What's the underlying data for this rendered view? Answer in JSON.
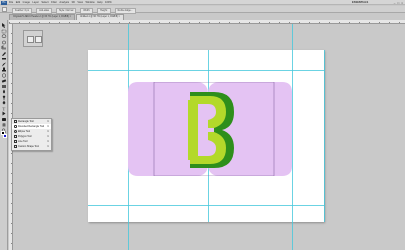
{
  "app": {
    "logo": "Ps",
    "essentials_label": "ESSENTIALS"
  },
  "menu": {
    "items": [
      "File",
      "Edit",
      "Image",
      "Layer",
      "Select",
      "Filter",
      "Analysis",
      "3D",
      "View",
      "Window",
      "Help"
    ],
    "zoom_value": "100%"
  },
  "window_controls": [
    "–",
    "□",
    "×"
  ],
  "options_bar": {
    "items": [
      "Feather: 0 px",
      "Anti-alias",
      "Style: Normal",
      "Width:",
      "Height:",
      "Refine Edge..."
    ]
  },
  "tabs": [
    {
      "label": "Original-Hi-3E9.6 Header-2 @ 66.7% (Layer 1, RGB/8) ×",
      "active": false
    },
    {
      "label": "Untitled-1 @ 66.7% (Layer 1, RGB/8) ×",
      "active": true
    }
  ],
  "toolbar": {
    "tools": [
      "move-tool",
      "marquee-tool",
      "lasso-tool",
      "quick-select-tool",
      "crop-tool",
      "eyedropper-tool",
      "healing-brush-tool",
      "brush-tool",
      "clone-stamp-tool",
      "history-brush-tool",
      "eraser-tool",
      "gradient-tool",
      "blur-tool",
      "dodge-tool",
      "pen-tool",
      "type-tool",
      "path-selection-tool",
      "shape-tool",
      "hand-tool",
      "zoom-tool"
    ],
    "foreground_color": "#000000",
    "background_color": "#1d1dcf"
  },
  "flyout": {
    "items": [
      {
        "label": "Rectangle Tool",
        "key": "U",
        "selected": false
      },
      {
        "label": "Rounded Rectangle Tool",
        "key": "U",
        "selected": true
      },
      {
        "label": "Ellipse Tool",
        "key": "U",
        "selected": false
      },
      {
        "label": "Polygon Tool",
        "key": "U",
        "selected": false
      },
      {
        "label": "Line Tool",
        "key": "U",
        "selected": false
      },
      {
        "label": "Custom Shape Tool",
        "key": "U",
        "selected": false
      }
    ]
  },
  "artwork": {
    "colors": {
      "lavender": "#e4c3f3",
      "outline": "#8a6aa6",
      "green_dark": "#2e8f1b",
      "green_light": "#b3d92a"
    }
  }
}
